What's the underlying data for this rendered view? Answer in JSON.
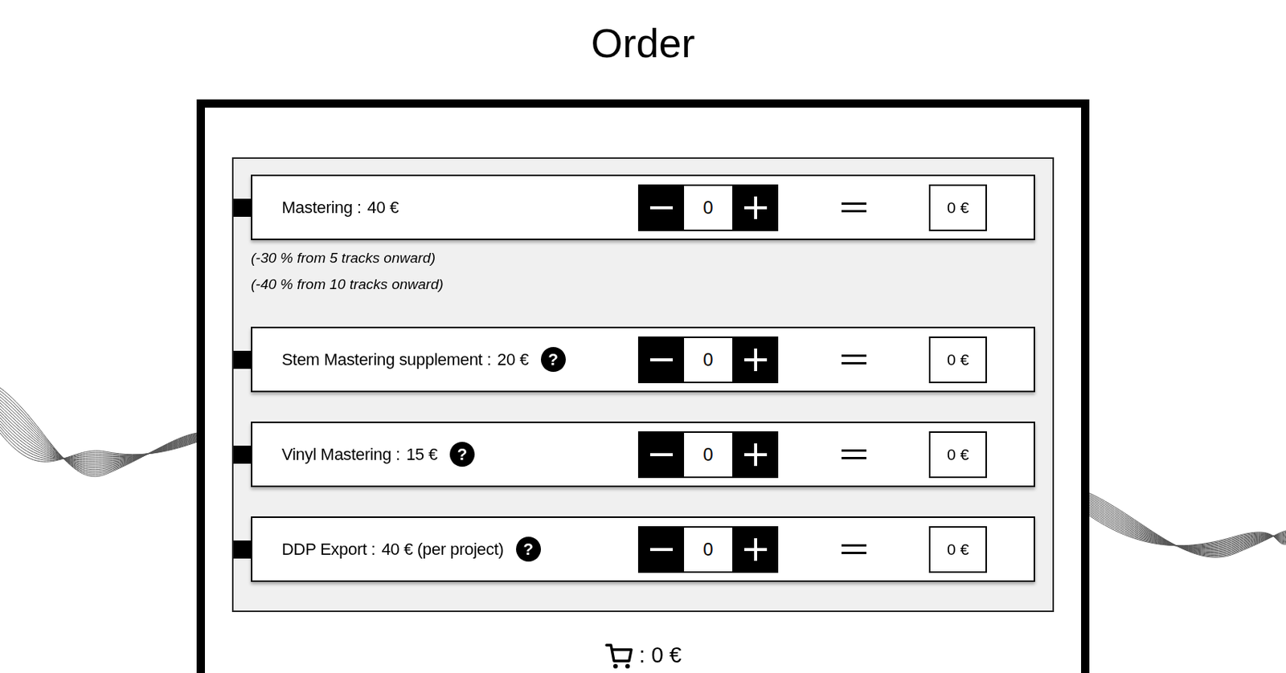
{
  "title": "Order",
  "services": [
    {
      "label": "Mastering :",
      "price": "40 €",
      "quantity": "0",
      "total": "0 €",
      "notes": [
        "(-30 % from 5 tracks onward)",
        "(-40 % from 10 tracks onward)"
      ]
    },
    {
      "label": "Stem Mastering supplement :",
      "price": "20 €",
      "help": "?",
      "quantity": "0",
      "total": "0 €"
    },
    {
      "label": "Vinyl Mastering :",
      "price": "15 €",
      "help": "?",
      "quantity": "0",
      "total": "0 €"
    },
    {
      "label": "DDP Export :",
      "price": "40 € (per project)",
      "help": "?",
      "quantity": "0",
      "total": "0 €"
    }
  ],
  "cart": {
    "total": ": 0 €"
  }
}
